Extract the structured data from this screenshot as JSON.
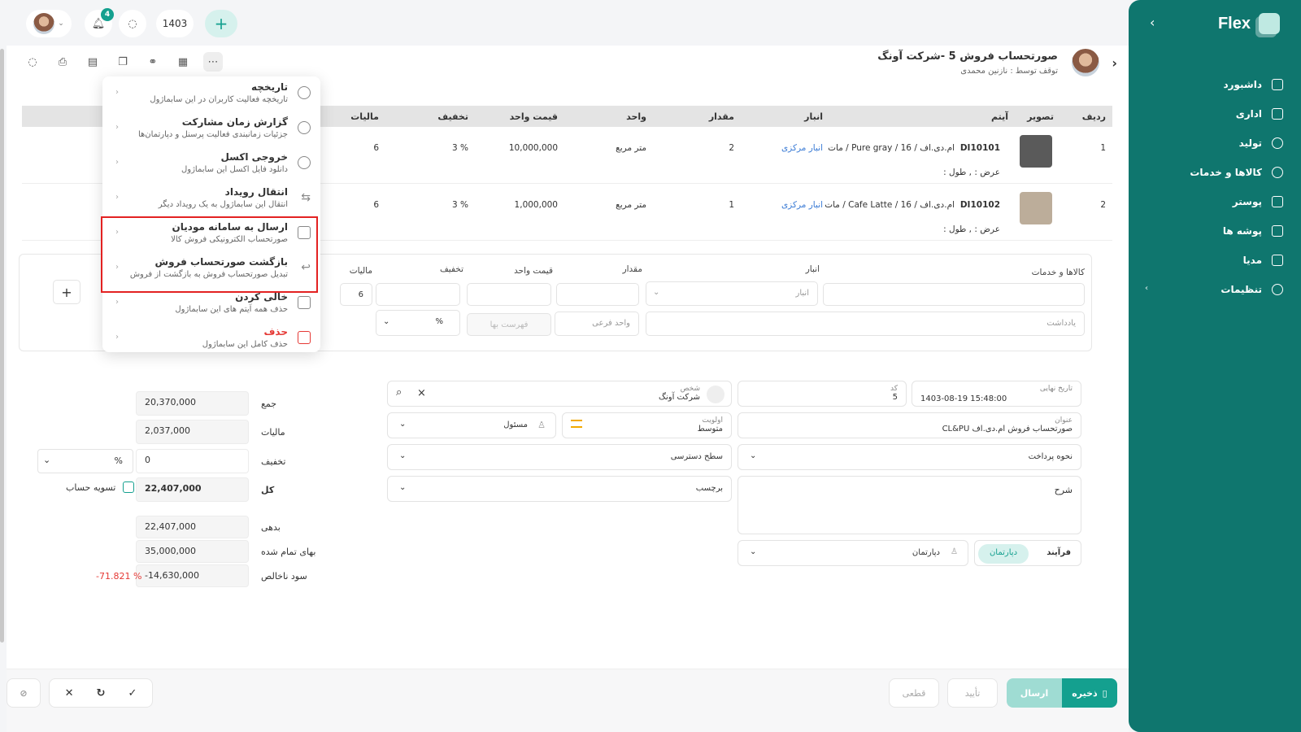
{
  "topbar": {
    "notif_count": "4",
    "year": "1403",
    "add": "+"
  },
  "sidebar": {
    "brand": "Flex",
    "items": [
      {
        "label": "داشبورد"
      },
      {
        "label": "اداری"
      },
      {
        "label": "تولید"
      },
      {
        "label": "کالاها و خدمات"
      },
      {
        "label": "پوستر"
      },
      {
        "label": "پوشه ها"
      },
      {
        "label": "مدیا"
      },
      {
        "label": "تنظیمات"
      }
    ]
  },
  "header": {
    "title": "صورتحساب فروش 5 -شرکت آونگ",
    "subtitle": "توقف توسط : نازنین محمدی"
  },
  "table": {
    "columns": {
      "row": "ردیف",
      "image": "تصویر",
      "item": "آیتم",
      "warehouse": "انبار",
      "qty": "مقدار",
      "unit": "واحد",
      "unit_price": "قیمت واحد",
      "discount": "تخفیف",
      "tax": "مالیات"
    },
    "rows": [
      {
        "row": "1",
        "code": "DI10101",
        "desc": "ام.دی.اف / 16 / Pure gray / مات",
        "dims": "عرض : , طول :",
        "warehouse": "انبار مرکزی",
        "qty": "2",
        "unit": "متر مربع",
        "unit_price": "10,000,000",
        "discount": "3 %",
        "tax": "6",
        "color": "#5a5a5a"
      },
      {
        "row": "2",
        "code": "DI10102",
        "desc": "ام.دی.اف / 16 / Cafe Latte / مات",
        "dims": "عرض : , طول :",
        "warehouse": "انبار مرکزی",
        "qty": "1",
        "unit": "متر مربع",
        "unit_price": "1,000,000",
        "discount": "3 %",
        "tax": "6",
        "color": "#bcad9a"
      }
    ]
  },
  "addform": {
    "goods_label": "کالاها و خدمات",
    "warehouse_label": "انبار",
    "warehouse_ph": "انبار",
    "qty_label": "مقدار",
    "unit_price_label": "قیمت واحد",
    "discount_label": "تخفیف",
    "tax_label": "مالیات",
    "tax_val": "6",
    "note_ph": "یادداشت",
    "sub_unit_ph": "واحد فرعی",
    "price_list_ph": "فهرست بها",
    "percent": "%",
    "add": "+"
  },
  "menu": [
    {
      "title": "تاریخچه",
      "desc": "تاریخچه فعالیت کاربران در این سابماژول"
    },
    {
      "title": "گزارش زمان مشارکت",
      "desc": "جزئیات زمانبندی فعالیت پرسنل و دپارتمان‌ها"
    },
    {
      "title": "خروجی اکسل",
      "desc": "دانلود فایل اکسل این سابماژول"
    },
    {
      "title": "انتقال رویداد",
      "desc": "انتقال این سابماژول به یک رویداد دیگر"
    },
    {
      "title": "ارسال به سامانه مودیان",
      "desc": "صورتحساب الکترونیکی فروش کالا"
    },
    {
      "title": "بازگشت صورتحساب فروش",
      "desc": "تبدیل صورتحساب فروش به بازگشت از فروش"
    },
    {
      "title": "خالی کردن",
      "desc": "حذف همه آیتم های این سابماژول"
    },
    {
      "title": "حذف",
      "desc": "حذف کامل این سابماژول"
    }
  ],
  "form": {
    "due_date_label": "تاریخ نهایی",
    "due_date": "1403-08-19 15:48:00",
    "code_label": "کد",
    "code": "5",
    "person_label": "شخص",
    "person": "شرکت آونگ",
    "title_label": "عنوان",
    "title": "صورتحساب فروش ام.دی.اف CL&PU",
    "priority_label": "اولویت",
    "priority": "متوسط",
    "owner": "مسئول",
    "payment": "نحوه پرداخت",
    "access": "سطح دسترسی",
    "description": "شرح",
    "tag": "برچسب",
    "process": "فرآیند",
    "department_tab": "دپارتمان",
    "department": "دپارتمان"
  },
  "summary": {
    "sum_label": "جمع",
    "sum": "20,370,000",
    "tax_label": "مالیات",
    "tax": "2,037,000",
    "discount_label": "تخفیف",
    "discount": "0",
    "percent": "%",
    "total_label": "کل",
    "total": "22,407,000",
    "settle_label": "تسویه حساب",
    "debt_label": "بدهی",
    "debt": "22,407,000",
    "cost_label": "بهای تمام شده",
    "cost": "35,000,000",
    "gross_label": "سود ناخالص",
    "gross": "-14,630,000",
    "gross_pct": "-71.821 %"
  },
  "footer": {
    "save": "ذخیره",
    "send": "ارسال",
    "approve": "تأیید",
    "final": "قطعی"
  }
}
